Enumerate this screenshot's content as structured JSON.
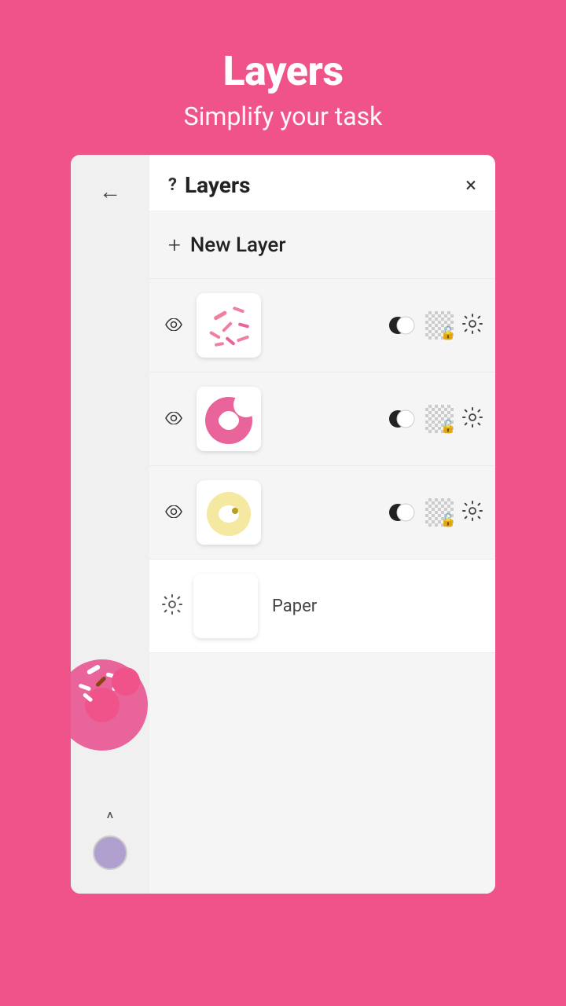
{
  "header": {
    "title": "Layers",
    "subtitle": "Simplify your task"
  },
  "panel": {
    "title": "Layers",
    "help_label": "?",
    "close_label": "×",
    "new_layer_label": "New Layer",
    "plus_label": "+"
  },
  "layers": [
    {
      "id": "layer-1",
      "type": "drawing",
      "visible": true,
      "thumbnail": "sprinkles"
    },
    {
      "id": "layer-2",
      "type": "drawing",
      "visible": true,
      "thumbnail": "donut-pink"
    },
    {
      "id": "layer-3",
      "type": "drawing",
      "visible": true,
      "thumbnail": "donut-yellow"
    },
    {
      "id": "layer-4",
      "type": "paper",
      "label": "Paper",
      "thumbnail": "paper"
    }
  ],
  "sidebar": {
    "back_label": "←",
    "chevron_label": "^"
  },
  "colors": {
    "background": "#F0538A",
    "panel_bg": "#FFFFFF",
    "sidebar_bg": "#f0f0f0",
    "layers_bg": "#f5f5f5",
    "color_circle": "#b0a0d0"
  }
}
